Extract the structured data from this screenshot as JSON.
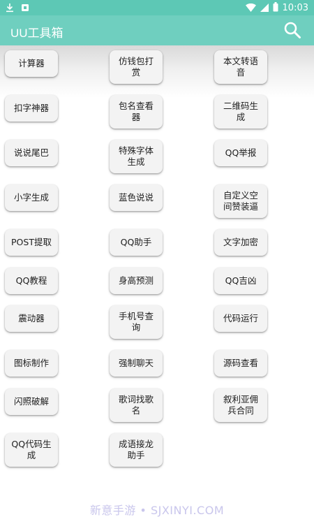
{
  "status": {
    "time": "10:03"
  },
  "app": {
    "title": "UU工具箱"
  },
  "tools": [
    "计算器",
    "仿钱包打赏",
    "本文转语音",
    "扣字神器",
    "包名查看器",
    "二维码生成",
    "说说尾巴",
    "特殊字体生成",
    "QQ举报",
    "小字生成",
    "蓝色说说",
    "自定义空间赞装逼",
    "POST提取",
    "QQ助手",
    "文字加密",
    "QQ教程",
    "身高预测",
    "QQ吉凶",
    "震动器",
    "手机号查询",
    "代码运行",
    "图标制作",
    "强制聊天",
    "源码查看",
    "闪照破解",
    "歌词找歌名",
    "叙利亚佣兵合同",
    "QQ代码生成",
    "成语接龙助手"
  ],
  "watermark": "新意手游 • SJXINYI.COM",
  "colors": {
    "status_bar": "#5dc8b5",
    "app_bar": "#6fcfbf"
  }
}
